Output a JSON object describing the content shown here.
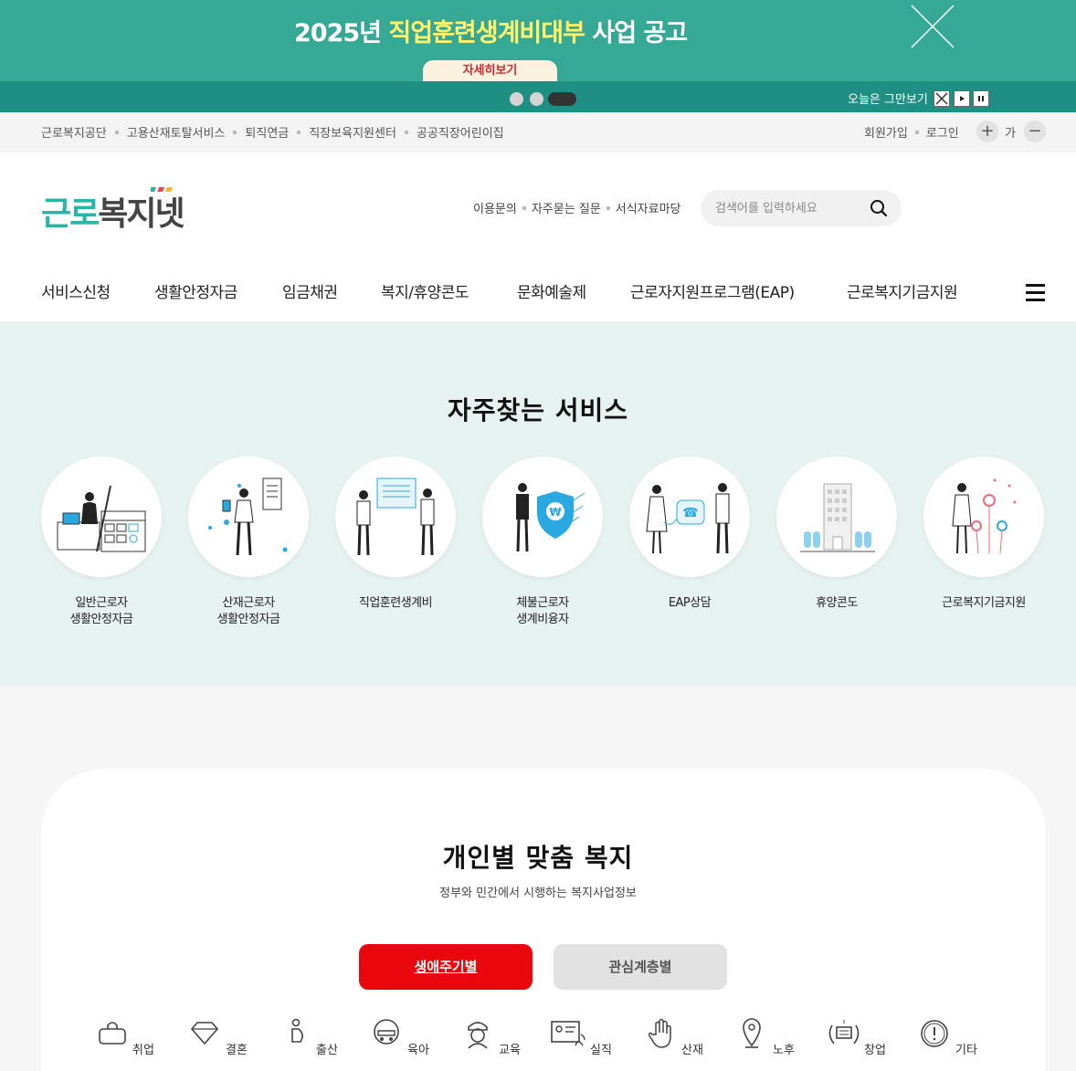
{
  "banner": {
    "title_prefix": "2025년 ",
    "title_highlight": "직업훈련생계비대부",
    "title_suffix": " 사업 공고",
    "detail_button": "자세히보기",
    "today_close_label": "오늘은 그만보기",
    "bg_color": "#35a996",
    "highlight_color": "#fff36b"
  },
  "util": {
    "links": [
      "근로복지공단",
      "고용산재토탈서비스",
      "퇴직연금",
      "직장보육지원센터",
      "공공직장어린이집"
    ],
    "join": "회원가입",
    "login": "로그인",
    "zoom_in": "+",
    "zoom_label": "가",
    "zoom_out": "−"
  },
  "header": {
    "logo_part1": "근로",
    "logo_part2": "복지넷",
    "links": [
      "이용문의",
      "자주묻는 질문",
      "서식자료마당"
    ],
    "search_placeholder": "검색어를 입력하세요"
  },
  "gnb": [
    "서비스신청",
    "생활안정자금",
    "임금채권",
    "복지/휴양콘도",
    "문화예술제",
    "근로자지원프로그램(EAP)",
    "근로복지기금지원"
  ],
  "frequent": {
    "title": "자주찾는 서비스",
    "services": [
      {
        "line1": "일반근로자",
        "line2": "생활안정자금"
      },
      {
        "line1": "산재근로자",
        "line2": "생활안정자금"
      },
      {
        "line1": "직업훈련생계비",
        "line2": ""
      },
      {
        "line1": "체불근로자",
        "line2": "생계비융자"
      },
      {
        "line1": "EAP상담",
        "line2": ""
      },
      {
        "line1": "휴양콘도",
        "line2": ""
      },
      {
        "line1": "근로복지기금지원",
        "line2": ""
      }
    ]
  },
  "personal": {
    "title": "개인별 맞춤 복지",
    "subtitle": "정부와 민간에서 시행하는 복지사업정보",
    "tab_active": "생애주기별",
    "tab_inactive": "관심계층별",
    "active_color": "#e8070c",
    "categories": [
      "취업",
      "결혼",
      "출산",
      "육아",
      "교육",
      "실직",
      "산재",
      "노후",
      "창업",
      "기타"
    ]
  }
}
